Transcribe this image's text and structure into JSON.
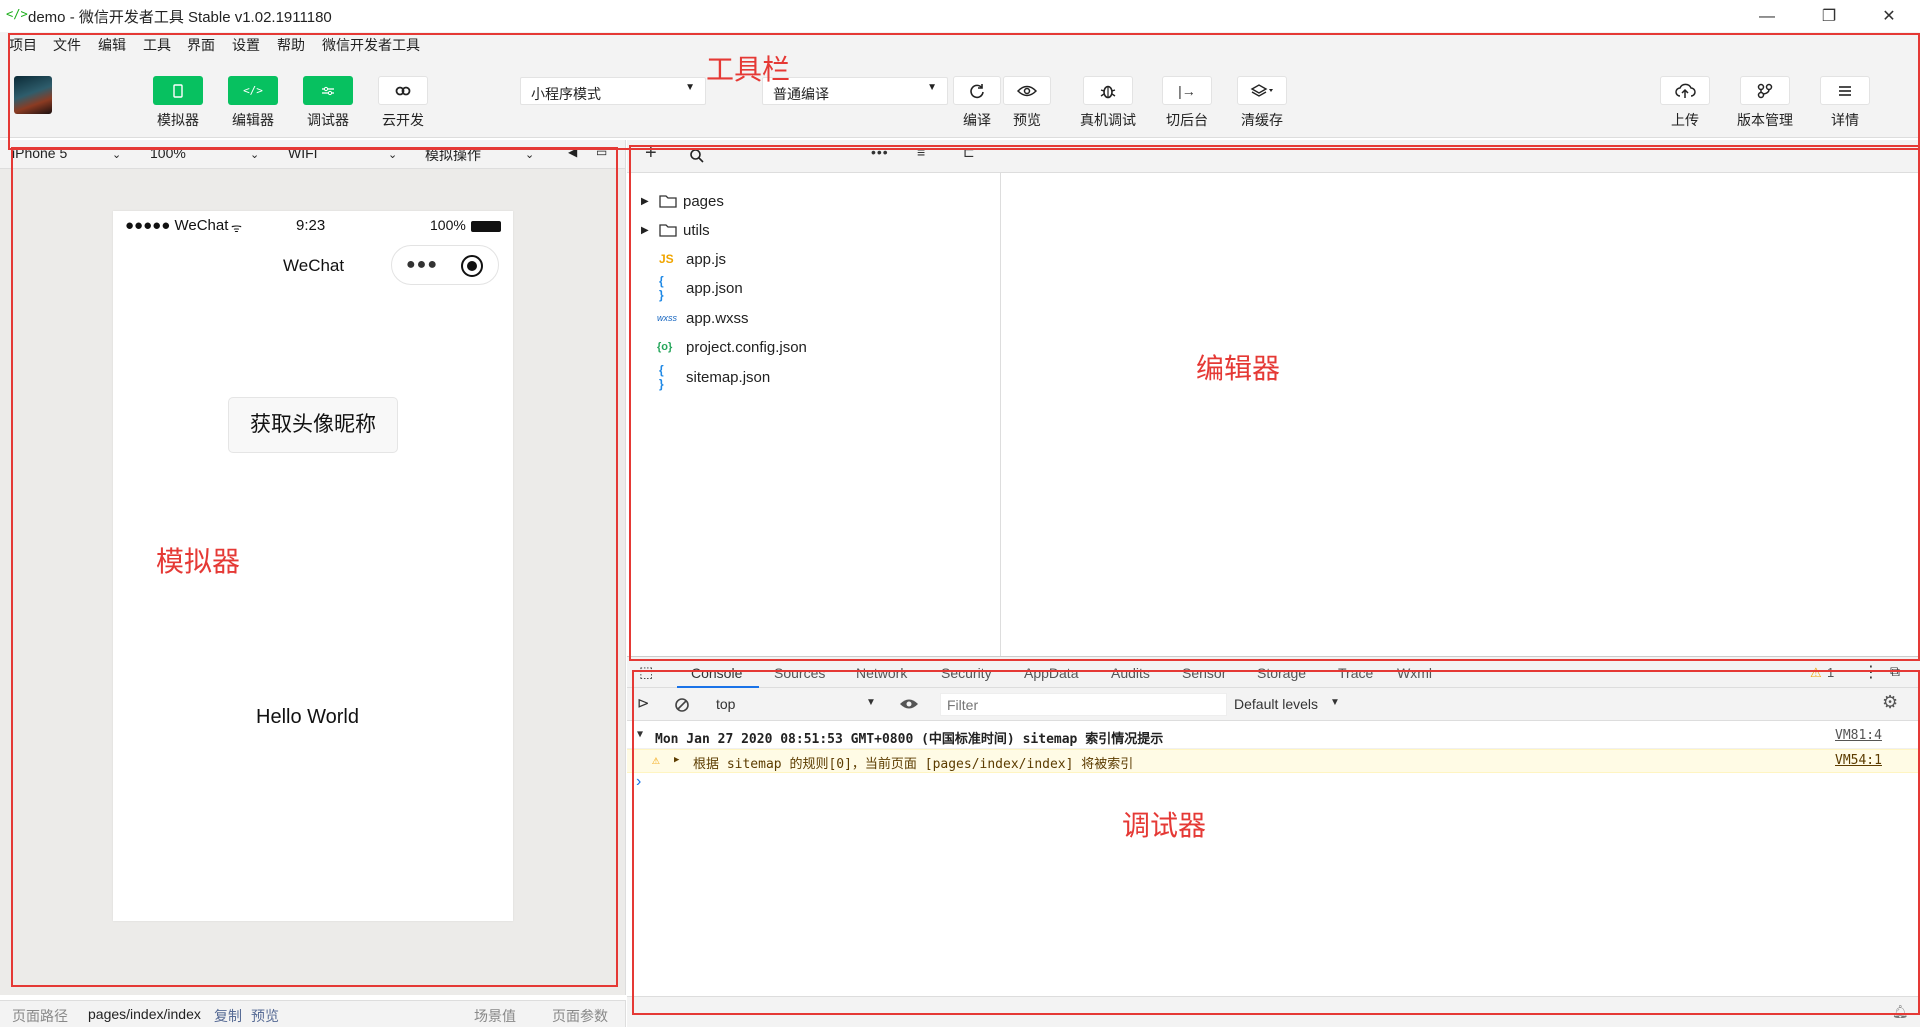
{
  "window": {
    "title": "demo - 微信开发者工具 Stable v1.02.1911180",
    "app_icon": "code-bracket-icon",
    "controls": [
      "minimize-icon",
      "restore-icon",
      "close-icon"
    ]
  },
  "menu": [
    "项目",
    "文件",
    "编辑",
    "工具",
    "界面",
    "设置",
    "帮助",
    "微信开发者工具"
  ],
  "toolbar": {
    "toggles": [
      {
        "label": "模拟器",
        "icon": "phone-icon"
      },
      {
        "label": "编辑器",
        "icon": "code-icon"
      },
      {
        "label": "调试器",
        "icon": "debug-icon"
      },
      {
        "label": "云开发",
        "icon": "cloud-link-icon"
      }
    ],
    "mode_select": "小程序模式",
    "compile_select": "普通编译",
    "actions": [
      {
        "label": "编译",
        "icon": "refresh-icon"
      },
      {
        "label": "预览",
        "icon": "eye-icon"
      },
      {
        "label": "真机调试",
        "icon": "bug-icon"
      },
      {
        "label": "切后台",
        "icon": "background-icon"
      },
      {
        "label": "清缓存",
        "icon": "layers-icon"
      }
    ],
    "right_actions": [
      {
        "label": "上传",
        "icon": "upload-icon"
      },
      {
        "label": "版本管理",
        "icon": "branch-icon"
      },
      {
        "label": "详情",
        "icon": "menu-icon"
      }
    ]
  },
  "annotations": {
    "toolbar": "工具栏",
    "simulator": "模拟器",
    "editor": "编辑器",
    "debugger": "调试器"
  },
  "simulator": {
    "device": "iPhone 5",
    "zoom": "100%",
    "network": "WIFI",
    "operation": "模拟操作",
    "status": {
      "signal": "●●●●● WeChat",
      "time": "9:23",
      "battery": "100%"
    },
    "nav_title": "WeChat",
    "button": "获取头像昵称",
    "hello": "Hello World"
  },
  "footer": {
    "path_label": "页面路径",
    "path": "pages/index/index",
    "copy": "复制",
    "preview": "预览",
    "scene": "场景值",
    "params": "页面参数"
  },
  "files": [
    {
      "name": "pages",
      "type": "folder"
    },
    {
      "name": "utils",
      "type": "folder"
    },
    {
      "name": "app.js",
      "type": "js",
      "badge": "JS"
    },
    {
      "name": "app.json",
      "type": "json",
      "badge": "{ }"
    },
    {
      "name": "app.wxss",
      "type": "wxss",
      "badge": "wxss"
    },
    {
      "name": "project.config.json",
      "type": "config",
      "badge": "{o}"
    },
    {
      "name": "sitemap.json",
      "type": "json",
      "badge": "{ }"
    }
  ],
  "debugger": {
    "tabs": [
      "Console",
      "Sources",
      "Network",
      "Security",
      "AppData",
      "Audits",
      "Sensor",
      "Storage",
      "Trace",
      "Wxml"
    ],
    "warning_count": "1",
    "context": "top",
    "filter_placeholder": "Filter",
    "levels": "Default levels",
    "logs": [
      {
        "text": "Mon Jan 27 2020 08:51:53 GMT+0800 (中国标准时间) sitemap 索引情况提示",
        "src": "VM81:4"
      },
      {
        "text": "根据 sitemap 的规则[0]，当前页面 [pages/index/index] 将被索引",
        "src": "VM54:1"
      }
    ],
    "prompt": "›"
  },
  "colors": {
    "brand": "#07c160",
    "annotation": "#e53935",
    "warn_bg": "#fffbe5"
  }
}
